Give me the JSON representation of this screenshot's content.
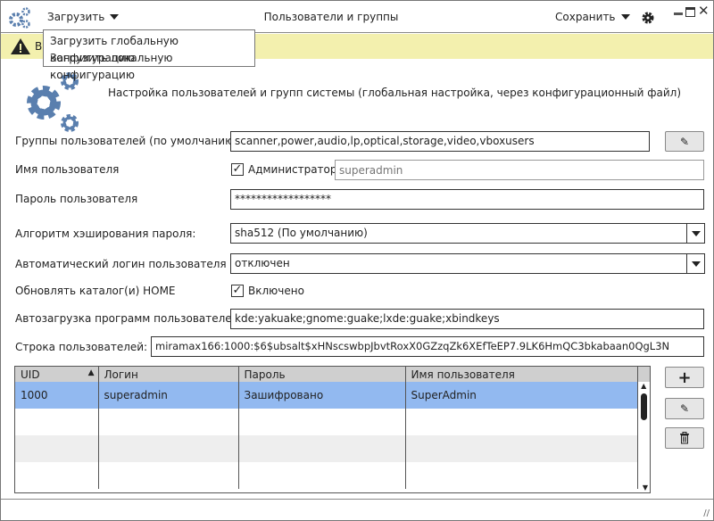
{
  "window": {
    "title": "Пользователи и группы",
    "load_menu": "Загрузить",
    "save_menu": "Сохранить"
  },
  "dropdown": {
    "items": [
      "Загрузить глобальную конфигурацию",
      "Загрузить локальную конфигурацию"
    ]
  },
  "banner": {
    "text": "В"
  },
  "header": {
    "title": "Настройка пользователей и групп системы (глобальная настройка, через конфигурационный файл)"
  },
  "form": {
    "groups": {
      "label": "Группы пользователей (по умолчанию)",
      "value": "scanner,power,audio,lp,optical,storage,video,vboxusers"
    },
    "username": {
      "label": "Имя пользователя",
      "admin_label": "Администратор",
      "admin_checked": true,
      "placeholder": "superadmin"
    },
    "password": {
      "label": "Пароль пользователя",
      "value": "******************"
    },
    "hash": {
      "label": "Алгоритм хэширования пароля:",
      "value": "sha512 (По умолчанию)"
    },
    "autologin": {
      "label": "Автоматический логин пользователя",
      "value": "отключен"
    },
    "home": {
      "label": "Обновлять каталог(и) HOME",
      "check_label": "Включено",
      "checked": true
    },
    "autostart": {
      "label": "Автозагрузка программ пользователей",
      "value": "kde:yakuake;gnome:guake;lxde:guake;xbindkeys"
    },
    "userstring": {
      "label": "Строка пользователей:",
      "value": "miramax166:1000:$6$ubsalt$xHNscswbpJbvtRoxX0GZzqZk6XEfTeEP7.9LK6HmQC3bkabaan0QgL3N"
    }
  },
  "table": {
    "columns": [
      "UID",
      "Логин",
      "Пароль",
      "Имя пользователя"
    ],
    "sort_column": "UID",
    "rows": [
      [
        "1000",
        "superadmin",
        "Зашифровано",
        "SuperAdmin"
      ]
    ]
  },
  "colors": {
    "accent": "#5a7fae",
    "banner": "#f3f0ae",
    "selection": "#92b9f0"
  }
}
